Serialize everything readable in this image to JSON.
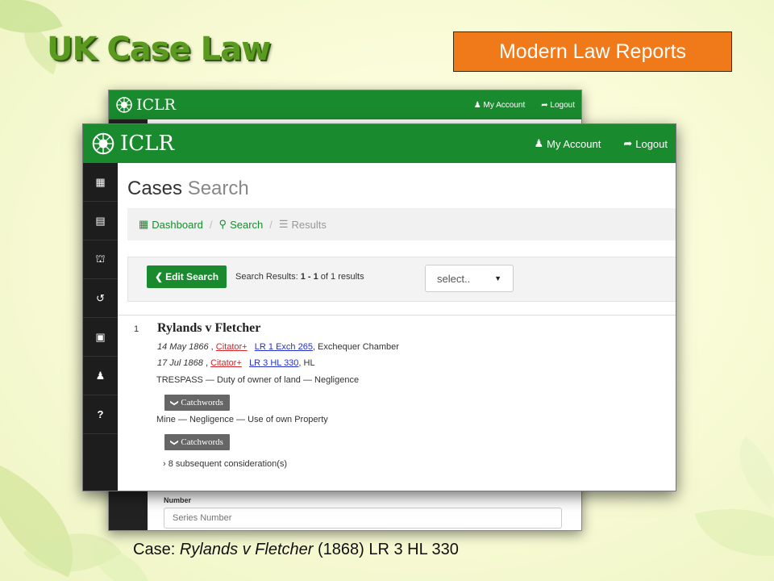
{
  "slide": {
    "title": "UK Case Law",
    "badge": "Modern Law Reports",
    "caption": {
      "prefix": "Case: ",
      "case_name": "Rylands v Fletcher",
      "suffix": " (1868) LR 3 HL 330"
    }
  },
  "back_window": {
    "brand": "ICLR",
    "my_account": "My Account",
    "logout": "Logout",
    "number_label": "Number",
    "series_placeholder": "Series Number"
  },
  "front_window": {
    "brand": "ICLR",
    "my_account": "My Account",
    "logout": "Logout",
    "sidebar_icons": [
      "dashboard-icon",
      "book-icon",
      "bank-icon",
      "history-icon",
      "briefcase-icon",
      "user-icon",
      "help-icon"
    ],
    "page_title_main": "Cases",
    "page_title_sub": "Search",
    "breadcrumb": {
      "dashboard": "Dashboard",
      "search": "Search",
      "results": "Results",
      "separator": "/"
    },
    "search_bar": {
      "edit_button": "Edit Search",
      "results_prefix": "Search Results: ",
      "results_range": "1 - 1",
      "results_of": " of ",
      "results_total": "1",
      "results_suffix": " results",
      "select_value": "select.."
    },
    "result": {
      "number": "1",
      "case_name": "Rylands v Fletcher",
      "citations": [
        {
          "date": "14 May 1866",
          "sep": " , ",
          "citator": "Citator+",
          "report": "LR 1 Exch 265",
          "court": ", Exchequer Chamber"
        },
        {
          "date": "17 Jul 1868",
          "sep": " , ",
          "citator": "Citator+",
          "report": "LR 3 HL 330",
          "court": ", HL"
        }
      ],
      "subject_1": "TRESPASS — Duty of owner of land — Negligence",
      "catchwords_label": "Catchwords",
      "subject_2": "Mine — Negligence — Use of own Property",
      "subsequent": "› 8 subsequent consideration(s)"
    }
  },
  "colors": {
    "brand_green": "#1a8a2e",
    "badge_orange": "#f07a1a",
    "title_green": "#5a9a1e",
    "citator_red": "#d0262a",
    "link_blue": "#2430c8"
  }
}
